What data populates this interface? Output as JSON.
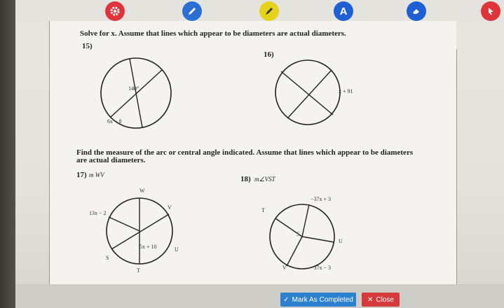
{
  "toolbar": {
    "tools": [
      {
        "name": "settings",
        "icon": "gear-icon",
        "color": "#e0343c"
      },
      {
        "name": "pen",
        "icon": "pencil-icon",
        "color": "#2b6fd6"
      },
      {
        "name": "highlighter",
        "icon": "highlighter-icon",
        "color": "#e6d21b"
      },
      {
        "name": "text",
        "icon": "text-icon",
        "color": "#1f5fd4",
        "glyph": "A"
      },
      {
        "name": "eraser",
        "icon": "eraser-icon",
        "color": "#1f5fd4"
      },
      {
        "name": "pointer",
        "icon": "cursor-icon",
        "color": "#e0343c"
      }
    ]
  },
  "worksheet": {
    "instructions1": "Solve for x.  Assume that lines which appear to be diameters are actual diameters.",
    "q15": {
      "number": "15)",
      "angle_label": "140°",
      "expr_label": "6x − 8"
    },
    "q16": {
      "number": "16)",
      "expr_label": "x + 91"
    },
    "instructions2": "Find the measure of the arc or central angle indicated.  Assume that lines which appear to be diameters",
    "instructions2b": "are actual diameters.",
    "q17": {
      "number": "17)",
      "target": "m WV",
      "labels": {
        "W": "W",
        "V": "V",
        "U": "U",
        "S": "S",
        "T": "T",
        "left_expr": "13x − 2",
        "center_expr": "5x + 10"
      }
    },
    "q18": {
      "number": "18)",
      "target": "m∠VST",
      "labels": {
        "T": "T",
        "U": "U",
        "V": "V",
        "S": "S",
        "top_expr": "−37x + 3",
        "bottom_expr": "−37x − 3"
      }
    }
  },
  "actions": {
    "mark_completed": "Mark As Completed",
    "close": "Close",
    "mark_color": "#2d7fd0",
    "close_color": "#d63a3a"
  }
}
